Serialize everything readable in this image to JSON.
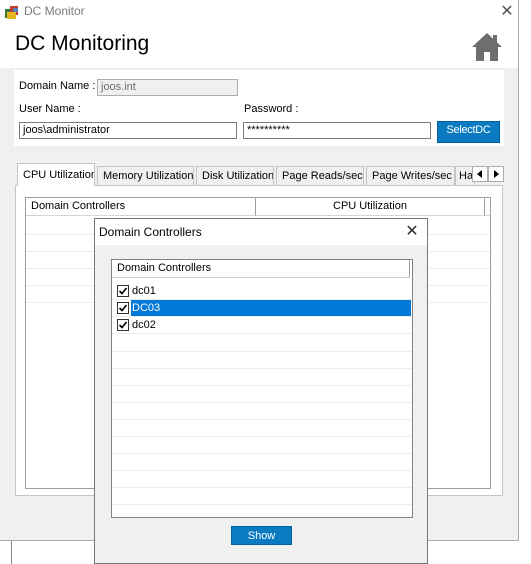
{
  "window": {
    "title": "DC Monitor",
    "close_glyph": "✕"
  },
  "header": {
    "title": "DC Monitoring",
    "home_icon": "home-icon"
  },
  "form": {
    "domain_label": "Domain Name :",
    "domain_value": "joos.int",
    "user_label": "User Name :",
    "user_value": "joos\\administrator",
    "password_label": "Password :",
    "password_value": "**********",
    "select_dc_label": "SelectDC"
  },
  "tabs": [
    {
      "label": "CPU Utilization",
      "active": true
    },
    {
      "label": "Memory Utilization"
    },
    {
      "label": "Disk Utilization"
    },
    {
      "label": "Page Reads/sec"
    },
    {
      "label": "Page Writes/sec"
    },
    {
      "label": "Ha"
    }
  ],
  "grid": {
    "columns": [
      "Domain Controllers",
      "CPU Utilization"
    ]
  },
  "dialog": {
    "title": "Domain Controllers",
    "close_glyph": "✕",
    "list_header": "Domain Controllers",
    "items": [
      {
        "name": "dc01",
        "checked": true,
        "selected": false
      },
      {
        "name": "DC03",
        "checked": true,
        "selected": true
      },
      {
        "name": "dc02",
        "checked": true,
        "selected": false
      }
    ],
    "show_label": "Show"
  },
  "colors": {
    "accent": "#0a7bc0",
    "selection": "#0078d7"
  }
}
